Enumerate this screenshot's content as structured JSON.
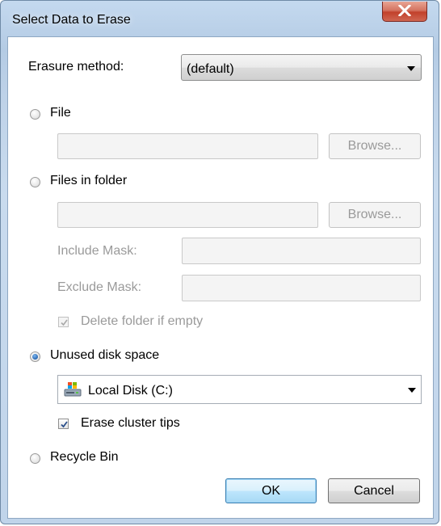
{
  "window": {
    "title": "Select Data to Erase"
  },
  "erasure": {
    "label": "Erasure method:",
    "value": "(default)"
  },
  "file": {
    "label": "File",
    "path": "",
    "browse": "Browse..."
  },
  "folder": {
    "label": "Files in folder",
    "path": "",
    "browse": "Browse...",
    "include_label": "Include Mask:",
    "include_value": "",
    "exclude_label": "Exclude Mask:",
    "exclude_value": "",
    "delete_empty_label": "Delete folder if empty"
  },
  "unused": {
    "label": "Unused disk space",
    "drive": "Local Disk (C:)",
    "cluster_tips_label": "Erase cluster tips"
  },
  "recycle": {
    "label": "Recycle Bin"
  },
  "buttons": {
    "ok": "OK",
    "cancel": "Cancel"
  },
  "selected_target": "Unused disk space",
  "icons": {
    "close": "close-icon",
    "drive": "drive-icon",
    "check": "check-icon",
    "dropdown": "chevron-down-icon"
  }
}
